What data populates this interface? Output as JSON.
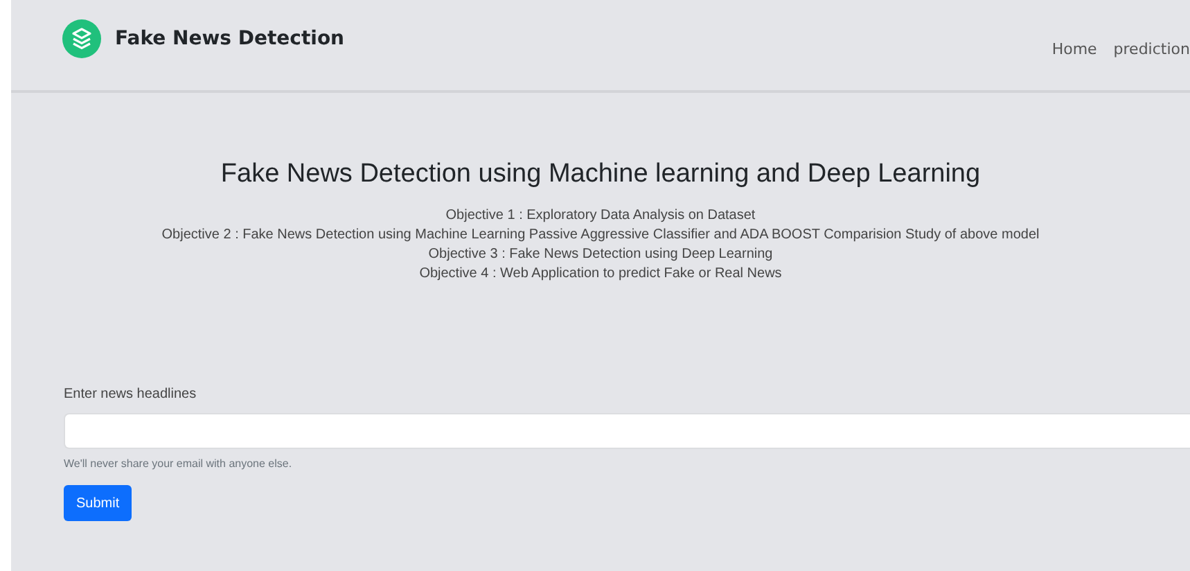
{
  "navbar": {
    "brand": "Fake News Detection",
    "links": [
      {
        "label": "Home"
      },
      {
        "label": "prediction"
      }
    ]
  },
  "hero": {
    "title": "Fake News Detection using Machine learning and Deep Learning",
    "objectives": [
      "Objective 1 : Exploratory Data Analysis on Dataset",
      "Objective 2 : Fake News Detection using Machine Learning Passive Aggressive Classifier and ADA BOOST Comparision Study of above model",
      "Objective 3 : Fake News Detection using Deep Learning",
      "Objective 4 : Web Application to predict Fake or Real News"
    ]
  },
  "form": {
    "label": "Enter news headlines",
    "help": "We'll never share your email with anyone else.",
    "button": "Submit"
  }
}
